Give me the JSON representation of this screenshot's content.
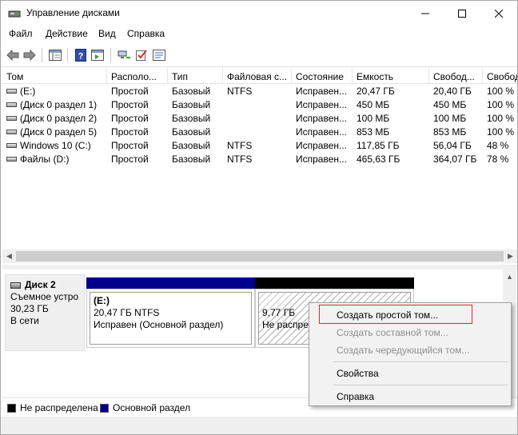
{
  "window": {
    "title": "Управление дисками"
  },
  "menu": [
    "Файл",
    "Действие",
    "Вид",
    "Справка"
  ],
  "toolbar": {
    "buttons": [
      "back-icon",
      "forward-icon",
      "console-tree-icon",
      "help-icon",
      "details-icon",
      "connect-icon",
      "check-icon",
      "properties-icon"
    ]
  },
  "volume_list": {
    "columns": [
      "Том",
      "Располо...",
      "Тип",
      "Файловая с...",
      "Состояние",
      "Емкость",
      "Свобод...",
      "Свобод"
    ],
    "rows": [
      [
        "(E:)",
        "Простой",
        "Базовый",
        "NTFS",
        "Исправен...",
        "20,47 ГБ",
        "20,40 ГБ",
        "100 %"
      ],
      [
        "(Диск 0 раздел 1)",
        "Простой",
        "Базовый",
        "",
        "Исправен...",
        "450 МБ",
        "450 МБ",
        "100 %"
      ],
      [
        "(Диск 0 раздел 2)",
        "Простой",
        "Базовый",
        "",
        "Исправен...",
        "100 МБ",
        "100 МБ",
        "100 %"
      ],
      [
        "(Диск 0 раздел 5)",
        "Простой",
        "Базовый",
        "",
        "Исправен...",
        "853 МБ",
        "853 МБ",
        "100 %"
      ],
      [
        "Windows 10 (C:)",
        "Простой",
        "Базовый",
        "NTFS",
        "Исправен...",
        "117,85 ГБ",
        "56,04 ГБ",
        "48 %"
      ],
      [
        "Файлы (D:)",
        "Простой",
        "Базовый",
        "NTFS",
        "Исправен...",
        "465,63 ГБ",
        "364,07 ГБ",
        "78 %"
      ]
    ]
  },
  "disk": {
    "name": "Диск 2",
    "type": "Съемное устро",
    "size": "30,23 ГБ",
    "status": "В сети"
  },
  "partitions": [
    {
      "title": "(E:)",
      "line2": "20,47 ГБ NTFS",
      "line3": "Исправен (Основной раздел)",
      "bar_color": "#00008b"
    },
    {
      "title": "",
      "line2": "9,77 ГБ",
      "line3": "Не распре",
      "bar_color": "#000000"
    }
  ],
  "legend": [
    {
      "label": "Не распределена",
      "color": "#000000"
    },
    {
      "label": "Основной раздел",
      "color": "#00008b"
    }
  ],
  "context_menu": {
    "items": [
      {
        "label": "Создать простой том...",
        "enabled": true
      },
      {
        "label": "Создать составной том...",
        "enabled": false
      },
      {
        "label": "Создать чередующийся том...",
        "enabled": false
      },
      {
        "label": "Свойства",
        "enabled": true
      },
      {
        "label": "Справка",
        "enabled": true
      }
    ],
    "highlight_color": "#e0282c"
  }
}
